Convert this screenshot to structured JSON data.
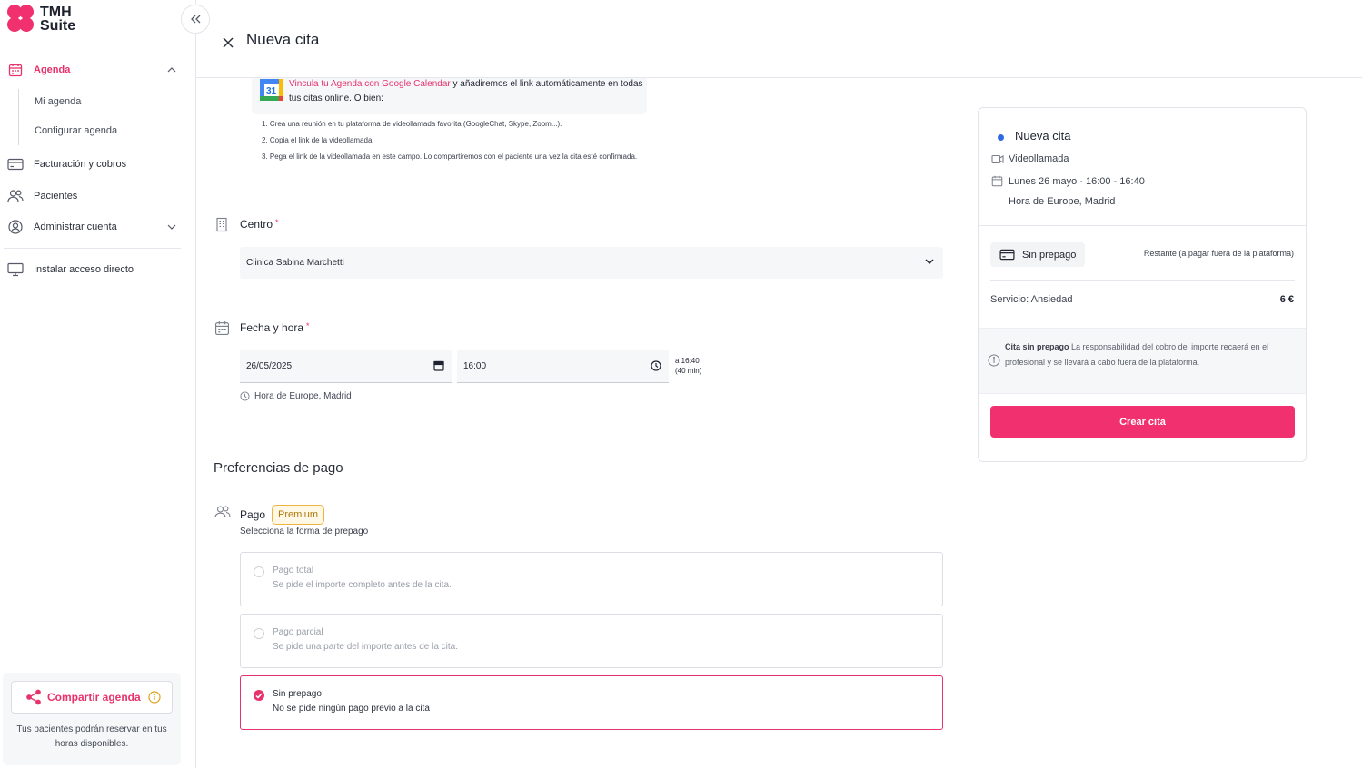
{
  "brand": {
    "name_line1": "TMH",
    "name_line2": "Suite",
    "accent": "#f0306f"
  },
  "sidebar": {
    "items": [
      {
        "label": "Agenda",
        "icon": "calendar-icon",
        "active": true
      },
      {
        "label": "Facturación y cobros",
        "icon": "card-icon"
      },
      {
        "label": "Pacientes",
        "icon": "users-icon"
      },
      {
        "label": "Administrar cuenta",
        "icon": "account-icon"
      },
      {
        "label": "Instalar acceso directo",
        "icon": "monitor-icon"
      }
    ],
    "sub_items": [
      {
        "label": "Mi agenda"
      },
      {
        "label": "Configurar agenda"
      }
    ],
    "share": {
      "button_label": "Compartir agenda",
      "text": "Tus pacientes podrán reservar en tus horas disponibles."
    }
  },
  "header": {
    "title": "Nueva cita"
  },
  "google_calendar": {
    "link_text": "Vincula tu Agenda con Google Calendar",
    "text": " y añadiremos el link automáticamente en todas tus citas online. O bien:",
    "icon_day": "31",
    "steps": [
      "1. Crea una reunión en tu plataforma de videollamada favorita (GoogleChat, Skype, Zoom...).",
      "2. Copia el link de la videollamada.",
      "3. Pega el link de la videollamada en este campo. Lo compartiremos con el paciente una vez la cita esté confirmada."
    ]
  },
  "form": {
    "centro": {
      "label": "Centro",
      "required_mark": "*",
      "value": "Clinica Sabina Marchetti"
    },
    "fecha": {
      "label": "Fecha y hora",
      "required_mark": "*",
      "date_value": "26/05/2025",
      "time_value": "16:00",
      "until_line1": "a 16:40",
      "until_line2": "(40 min)",
      "timezone": "Hora de Europe, Madrid"
    }
  },
  "payment": {
    "section_title": "Preferencias de pago",
    "label": "Pago",
    "badge": "Premium",
    "subtitle": "Selecciona la forma de prepago",
    "options": [
      {
        "title": "Pago total",
        "desc": "Se pide el importe completo antes de la cita.",
        "selected": false
      },
      {
        "title": "Pago parcial",
        "desc": "Se pide una parte del importe antes de la cita.",
        "selected": false
      },
      {
        "title": "Sin prepago",
        "desc": "No se pide ningún pago previo a la cita",
        "selected": true
      }
    ]
  },
  "summary": {
    "title": "Nueva cita",
    "mode": "Videollamada",
    "datetime": "Lunes 26 mayo · 16:00 - 16:40",
    "timezone": "Hora de Europe, Madrid",
    "prepay_chip": "Sin prepago",
    "remaining": "Restante (a pagar fuera de la plataforma)",
    "service": "Servicio: Ansiedad",
    "price": "6 €",
    "notice_bold": "Cita sin prepago",
    "notice_text": " La responsabilidad del cobro del importe recaerá en el profesional y se llevará a cabo fuera de la plataforma.",
    "create_button": "Crear cita",
    "dot_color": "#2e6ae0"
  }
}
